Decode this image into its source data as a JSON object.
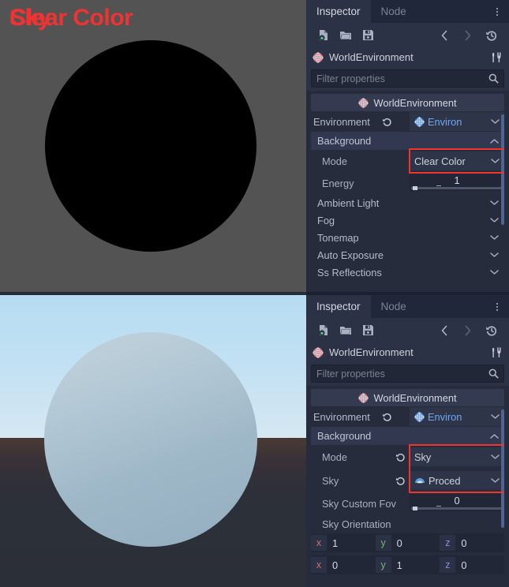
{
  "viewports": [
    {
      "label": "Clear Color",
      "label_color": "#ef3333",
      "background_color": "#535353",
      "sphere_color": "#000000"
    },
    {
      "label": "Sky",
      "label_color": "#ef3333",
      "sky_color_top": "#b6dcf2",
      "sky_color_horizon": "#d6e8f2",
      "ground_color": "#2b2f38",
      "sphere_color": "#a9c1d0"
    }
  ],
  "inspectors": [
    {
      "tabs": [
        {
          "label": "Inspector",
          "active": true
        },
        {
          "label": "Node",
          "active": false
        }
      ],
      "menu_icon": "kebab-menu-icon",
      "toolbar": {
        "left_icons": [
          "new-resource-icon",
          "open-folder-icon",
          "save-icon"
        ],
        "right_icons": [
          "history-previous-icon",
          "history-next-icon",
          "history-revert-icon"
        ]
      },
      "node": {
        "icon": "world-environment-icon",
        "name": "WorldEnvironment",
        "tools_icon": "object-tools-icon"
      },
      "filter": {
        "placeholder": "Filter properties",
        "value": "",
        "icon": "search-icon"
      },
      "class_header": {
        "icon": "world-environment-icon",
        "label": "WorldEnvironment"
      },
      "properties": [
        {
          "kind": "resource",
          "label": "Environment",
          "revert_icon": "revert-icon",
          "value_icon": "environment-icon",
          "value": "Environ",
          "dropdown_icon": "chevron-down-icon"
        },
        {
          "kind": "section",
          "label": "Background",
          "expanded": true,
          "caret_icon": "chevron-up-icon"
        },
        {
          "kind": "enum",
          "label": "Mode",
          "value": "Clear Color",
          "dropdown_icon": "chevron-down-icon",
          "highlighted": true
        },
        {
          "kind": "number",
          "label": "Energy",
          "value": "1",
          "slider_fraction": 0.03
        },
        {
          "kind": "subsection",
          "label": "Ambient Light",
          "caret_icon": "chevron-down-icon"
        },
        {
          "kind": "subsection",
          "label": "Fog",
          "caret_icon": "chevron-down-icon"
        },
        {
          "kind": "subsection",
          "label": "Tonemap",
          "caret_icon": "chevron-down-icon"
        },
        {
          "kind": "subsection",
          "label": "Auto Exposure",
          "caret_icon": "chevron-down-icon"
        },
        {
          "kind": "subsection",
          "label": "Ss Reflections",
          "caret_icon": "chevron-down-icon"
        }
      ]
    },
    {
      "tabs": [
        {
          "label": "Inspector",
          "active": true
        },
        {
          "label": "Node",
          "active": false
        }
      ],
      "menu_icon": "kebab-menu-icon",
      "toolbar": {
        "left_icons": [
          "new-resource-icon",
          "open-folder-icon",
          "save-icon"
        ],
        "right_icons": [
          "history-previous-icon",
          "history-next-icon",
          "history-revert-icon"
        ]
      },
      "node": {
        "icon": "world-environment-icon",
        "name": "WorldEnvironment",
        "tools_icon": "object-tools-icon"
      },
      "filter": {
        "placeholder": "Filter properties",
        "value": "",
        "icon": "search-icon"
      },
      "class_header": {
        "icon": "world-environment-icon",
        "label": "WorldEnvironment"
      },
      "properties": [
        {
          "kind": "resource",
          "label": "Environment",
          "revert_icon": "revert-icon",
          "value_icon": "environment-icon",
          "value": "Environ",
          "dropdown_icon": "chevron-down-icon"
        },
        {
          "kind": "section",
          "label": "Background",
          "expanded": true,
          "caret_icon": "chevron-up-icon"
        },
        {
          "kind": "enum",
          "label": "Mode",
          "revert_icon": "revert-icon",
          "value": "Sky",
          "dropdown_icon": "chevron-down-icon",
          "highlighted": true
        },
        {
          "kind": "resource",
          "label": "Sky",
          "revert_icon": "revert-icon",
          "value_icon": "procedural-sky-icon",
          "value": "Proced",
          "dropdown_icon": "chevron-down-icon",
          "highlighted": true
        },
        {
          "kind": "number",
          "label": "Sky Custom Fov",
          "value": "0",
          "slider_fraction": 0.0
        },
        {
          "kind": "grouplabel",
          "label": "Sky Orientation"
        },
        {
          "kind": "vector",
          "fields": [
            {
              "axis": "x",
              "value": "1"
            },
            {
              "axis": "y",
              "value": "0"
            },
            {
              "axis": "z",
              "value": "0"
            }
          ]
        },
        {
          "kind": "vector",
          "fields": [
            {
              "axis": "x",
              "value": "0"
            },
            {
              "axis": "y",
              "value": "1"
            },
            {
              "axis": "z",
              "value": "0"
            }
          ]
        }
      ]
    }
  ],
  "colors": {
    "accent_highlight": "#f0352f",
    "panel_bg": "#262c3b",
    "panel_alt": "#2b3245",
    "link_blue": "#6da8f5",
    "axis_x": "#d26f6f",
    "axis_y": "#72b86b",
    "axis_z": "#8b8ce0"
  }
}
